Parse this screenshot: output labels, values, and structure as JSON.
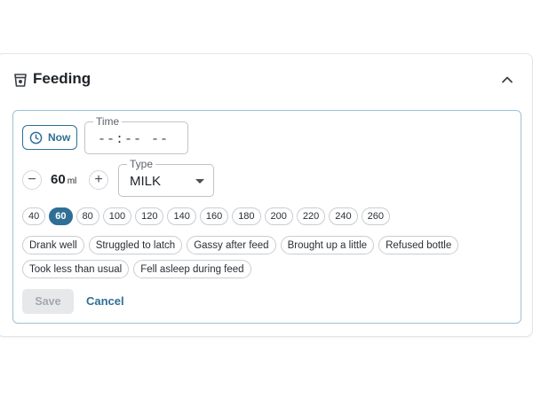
{
  "section": {
    "title": "Feeding"
  },
  "now_button": {
    "label": "Now"
  },
  "time_field": {
    "legend": "Time",
    "value": "--:-- --"
  },
  "amount": {
    "value": "60",
    "unit": "ml",
    "minus": "−",
    "plus": "+"
  },
  "type_field": {
    "legend": "Type",
    "value": "MILK"
  },
  "amount_presets": [
    "40",
    "60",
    "80",
    "100",
    "120",
    "140",
    "160",
    "180",
    "200",
    "220",
    "240",
    "260"
  ],
  "selected_preset": "60",
  "notes_row1": [
    "Drank well",
    "Struggled to latch",
    "Gassy after feed",
    "Brought up a little",
    "Refused bottle"
  ],
  "notes_row2": [
    "Took less than usual",
    "Fell asleep during feed"
  ],
  "actions": {
    "save": "Save",
    "cancel": "Cancel"
  },
  "colors": {
    "accent": "#2f6f95",
    "card_border": "#9ec0d6"
  }
}
